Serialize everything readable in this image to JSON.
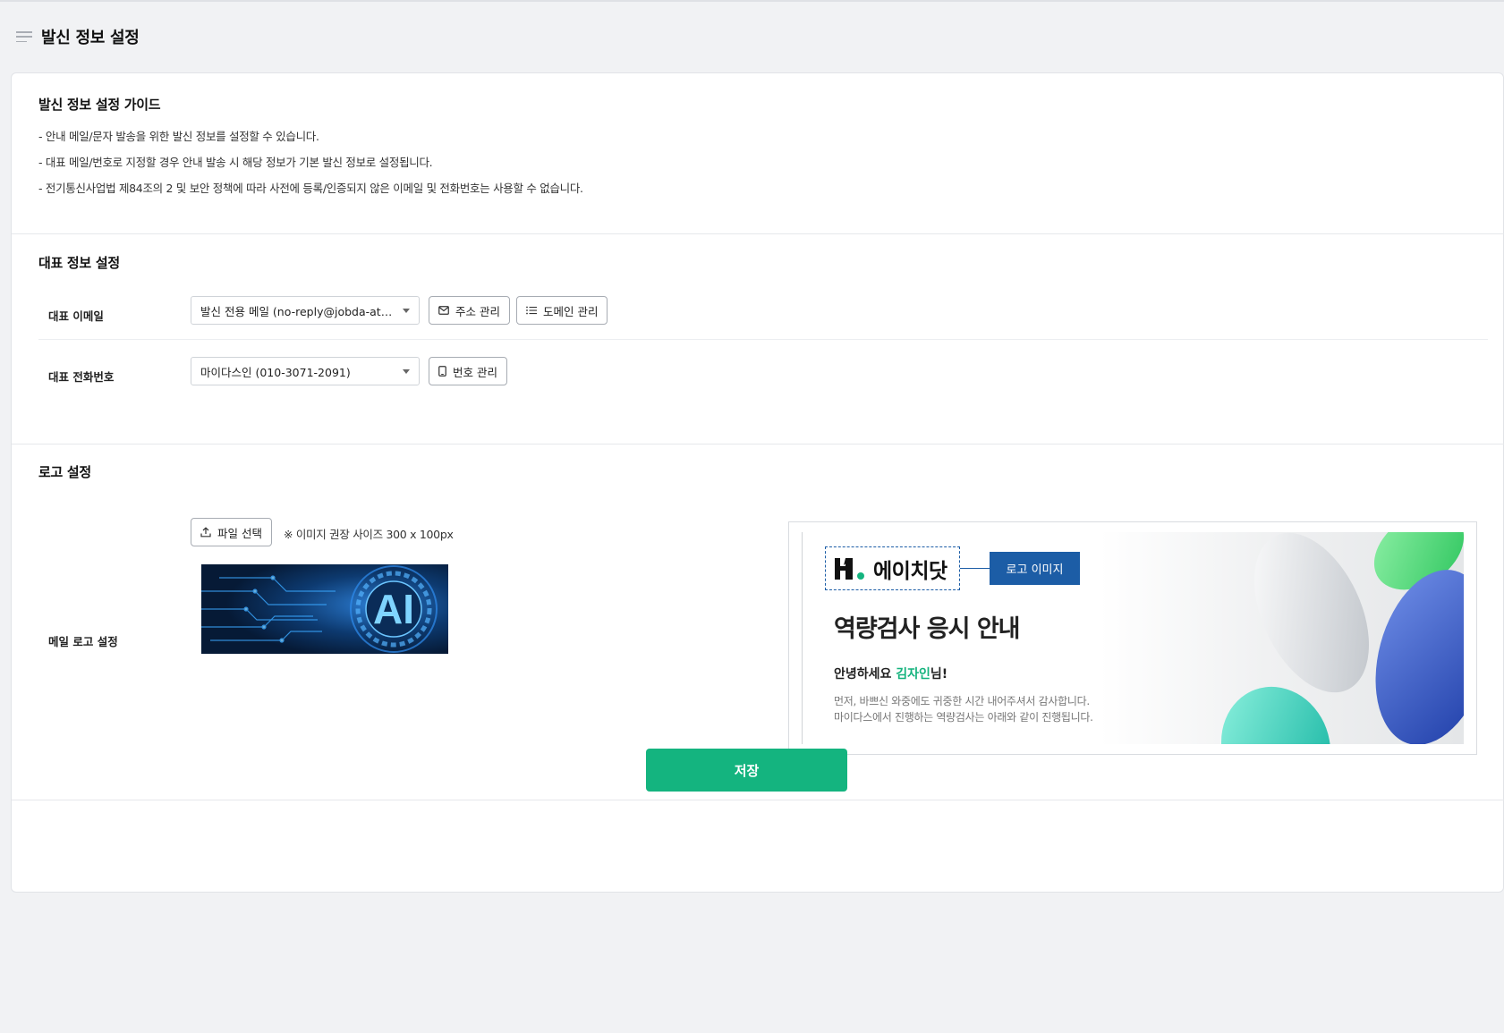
{
  "page": {
    "title": "발신 정보 설정"
  },
  "guide": {
    "title": "발신 정보 설정 가이드",
    "lines": [
      "- 안내 메일/문자 발송을 위한 발신 정보를 설정할 수 있습니다.",
      "- 대표 메일/번호로 지정할 경우 안내 발송 시 해당 정보가 기본 발신 정보로 설정됩니다.",
      "- 전기통신사업법 제84조의 2 및 보안 정책에 따라 사전에 등록/인증되지 않은 이메일 및 전화번호는 사용할 수 없습니다."
    ]
  },
  "representative": {
    "title": "대표 정보 설정",
    "email": {
      "label": "대표 이메일",
      "selected": "발신 전용 메일 (no-reply@jobda-ats...",
      "address_button": "주소 관리",
      "domain_button": "도메인 관리"
    },
    "phone": {
      "label": "대표 전화번호",
      "selected": "마이다스인 (010-3071-2091)",
      "number_button": "번호 관리"
    }
  },
  "logo": {
    "title": "로고 설정",
    "row_label": "메일 로고 설정",
    "file_button": "파일 선택",
    "size_hint": "※ 이미지 권장 사이즈 300 x 100px",
    "thumbnail_text": "AI",
    "preview": {
      "logo_text": "에이치닷",
      "logo_tag": "로고 이미지",
      "title": "역량검사 응시 안내",
      "hello_prefix": "안녕하세요 ",
      "hello_name": "김자인",
      "hello_suffix": "님!",
      "body_line1": "먼저, 바쁘신 와중에도 귀중한 시간 내어주셔서 감사합니다.",
      "body_line2": "마이다스에서 진행하는 역량검사는 아래와 같이 진행됩니다."
    }
  },
  "actions": {
    "save": "저장"
  },
  "colors": {
    "accent": "#14b47f",
    "logo_blue": "#1c5da6"
  }
}
